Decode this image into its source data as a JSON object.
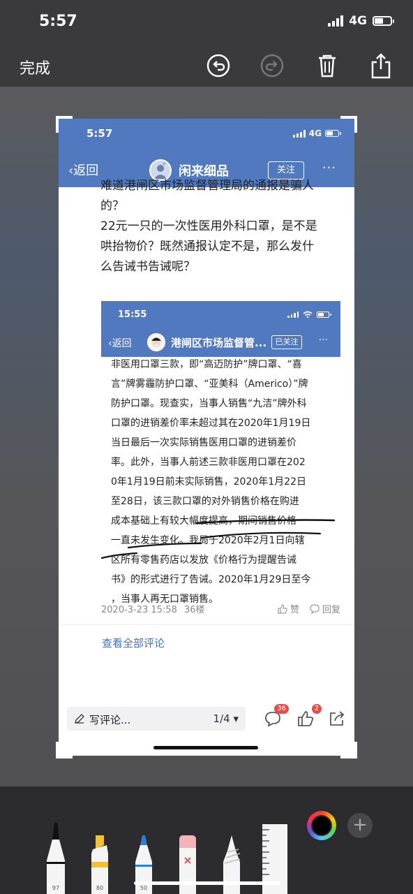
{
  "status_bar": {
    "time": "5:57",
    "network": "4G"
  },
  "toolbar": {
    "done_label": "完成"
  },
  "screenshot": {
    "status": {
      "time": "5:57",
      "network": "4G"
    },
    "nav": {
      "back_label": "返回",
      "title": "闲来细品",
      "follow_label": "关注",
      "more": "···"
    },
    "post_lines": [
      "难道港闸区市场监督管理局的通报是骗人",
      "的？",
      "22元一只的一次性医用外科口罩，是不是",
      "哄抬物价？既然通报认定不是，那么发什",
      "么告诫书告诫呢？"
    ],
    "nested": {
      "time": "15:55",
      "back_label": "返回",
      "title": "港闸区市场监督管...",
      "follow_label": "已关注",
      "more": "···",
      "lines": [
        "非医用口罩三款，即“高迈防护”牌口罩、“喜",
        "言”牌雾霾防护口罩、“亚美科（Americo）”牌",
        "防护口罩。现查实，当事人销售“九洁”牌外科",
        "口罩的进销差价率未超过其在2020年1月19日",
        "当日最后一次实际销售医用口罩的进销差价",
        "率。此外，当事人前述三款非医用口罩在202",
        "0年1月19日前未实际销售，2020年1月22日",
        "至28日，该三款口罩的对外销售价格在购进",
        "成本基础上有较大幅度提高，期间销售价格",
        "一直未发生变化。我局于2020年2月1日向辖",
        "区所有零售药店以发放《价格行为提醒告诫",
        "书》的形式进行了告诫。2020年1月29日至今",
        "，当事人再无口罩销售。"
      ]
    },
    "meta": {
      "timestamp": "2020-3-23 15:58",
      "floor": "36楼",
      "like_label": "赞",
      "reply_label": "回复"
    },
    "view_all_label": "查看全部评论",
    "bottom": {
      "comment_placeholder": "写评论...",
      "page_indicator": "1/4",
      "comment_count": "36",
      "like_count": "2"
    }
  },
  "palette": {
    "tools": [
      {
        "name": "pen",
        "label": "97"
      },
      {
        "name": "highlighter",
        "label": "80"
      },
      {
        "name": "pencil",
        "label": "50"
      },
      {
        "name": "eraser",
        "label": ""
      },
      {
        "name": "lasso",
        "label": ""
      },
      {
        "name": "ruler",
        "label": ""
      }
    ],
    "colors": {
      "accent_blue": "#5179c0",
      "link_blue": "#4a6fb5",
      "badge_red": "#e94a4a",
      "highlighter_yellow": "#f2c230",
      "pencil_blue": "#2f7fd6",
      "eraser_pink": "#f3b3b7"
    }
  }
}
